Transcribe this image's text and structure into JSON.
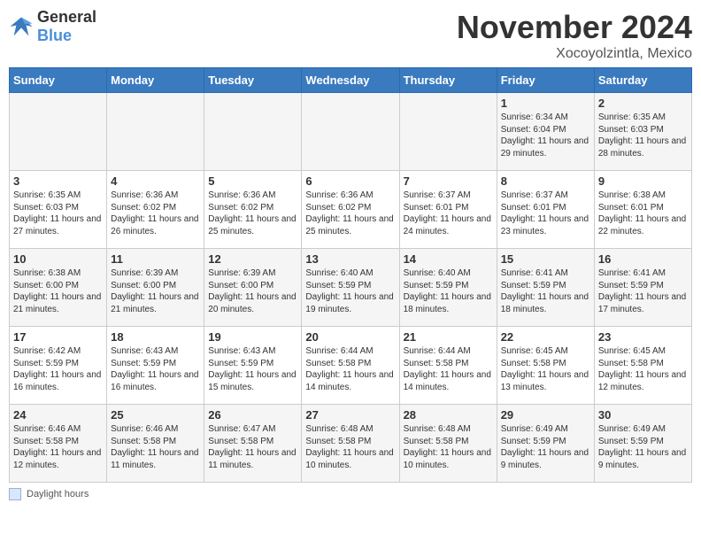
{
  "logo": {
    "general": "General",
    "blue": "Blue"
  },
  "header": {
    "month": "November 2024",
    "location": "Xocoyolzintla, Mexico"
  },
  "days_of_week": [
    "Sunday",
    "Monday",
    "Tuesday",
    "Wednesday",
    "Thursday",
    "Friday",
    "Saturday"
  ],
  "footer": {
    "daylight_label": "Daylight hours"
  },
  "weeks": [
    {
      "days": [
        {
          "num": "",
          "detail": ""
        },
        {
          "num": "",
          "detail": ""
        },
        {
          "num": "",
          "detail": ""
        },
        {
          "num": "",
          "detail": ""
        },
        {
          "num": "",
          "detail": ""
        },
        {
          "num": "1",
          "detail": "Sunrise: 6:34 AM\nSunset: 6:04 PM\nDaylight: 11 hours and 29 minutes."
        },
        {
          "num": "2",
          "detail": "Sunrise: 6:35 AM\nSunset: 6:03 PM\nDaylight: 11 hours and 28 minutes."
        }
      ]
    },
    {
      "days": [
        {
          "num": "3",
          "detail": "Sunrise: 6:35 AM\nSunset: 6:03 PM\nDaylight: 11 hours and 27 minutes."
        },
        {
          "num": "4",
          "detail": "Sunrise: 6:36 AM\nSunset: 6:02 PM\nDaylight: 11 hours and 26 minutes."
        },
        {
          "num": "5",
          "detail": "Sunrise: 6:36 AM\nSunset: 6:02 PM\nDaylight: 11 hours and 25 minutes."
        },
        {
          "num": "6",
          "detail": "Sunrise: 6:36 AM\nSunset: 6:02 PM\nDaylight: 11 hours and 25 minutes."
        },
        {
          "num": "7",
          "detail": "Sunrise: 6:37 AM\nSunset: 6:01 PM\nDaylight: 11 hours and 24 minutes."
        },
        {
          "num": "8",
          "detail": "Sunrise: 6:37 AM\nSunset: 6:01 PM\nDaylight: 11 hours and 23 minutes."
        },
        {
          "num": "9",
          "detail": "Sunrise: 6:38 AM\nSunset: 6:01 PM\nDaylight: 11 hours and 22 minutes."
        }
      ]
    },
    {
      "days": [
        {
          "num": "10",
          "detail": "Sunrise: 6:38 AM\nSunset: 6:00 PM\nDaylight: 11 hours and 21 minutes."
        },
        {
          "num": "11",
          "detail": "Sunrise: 6:39 AM\nSunset: 6:00 PM\nDaylight: 11 hours and 21 minutes."
        },
        {
          "num": "12",
          "detail": "Sunrise: 6:39 AM\nSunset: 6:00 PM\nDaylight: 11 hours and 20 minutes."
        },
        {
          "num": "13",
          "detail": "Sunrise: 6:40 AM\nSunset: 5:59 PM\nDaylight: 11 hours and 19 minutes."
        },
        {
          "num": "14",
          "detail": "Sunrise: 6:40 AM\nSunset: 5:59 PM\nDaylight: 11 hours and 18 minutes."
        },
        {
          "num": "15",
          "detail": "Sunrise: 6:41 AM\nSunset: 5:59 PM\nDaylight: 11 hours and 18 minutes."
        },
        {
          "num": "16",
          "detail": "Sunrise: 6:41 AM\nSunset: 5:59 PM\nDaylight: 11 hours and 17 minutes."
        }
      ]
    },
    {
      "days": [
        {
          "num": "17",
          "detail": "Sunrise: 6:42 AM\nSunset: 5:59 PM\nDaylight: 11 hours and 16 minutes."
        },
        {
          "num": "18",
          "detail": "Sunrise: 6:43 AM\nSunset: 5:59 PM\nDaylight: 11 hours and 16 minutes."
        },
        {
          "num": "19",
          "detail": "Sunrise: 6:43 AM\nSunset: 5:59 PM\nDaylight: 11 hours and 15 minutes."
        },
        {
          "num": "20",
          "detail": "Sunrise: 6:44 AM\nSunset: 5:58 PM\nDaylight: 11 hours and 14 minutes."
        },
        {
          "num": "21",
          "detail": "Sunrise: 6:44 AM\nSunset: 5:58 PM\nDaylight: 11 hours and 14 minutes."
        },
        {
          "num": "22",
          "detail": "Sunrise: 6:45 AM\nSunset: 5:58 PM\nDaylight: 11 hours and 13 minutes."
        },
        {
          "num": "23",
          "detail": "Sunrise: 6:45 AM\nSunset: 5:58 PM\nDaylight: 11 hours and 12 minutes."
        }
      ]
    },
    {
      "days": [
        {
          "num": "24",
          "detail": "Sunrise: 6:46 AM\nSunset: 5:58 PM\nDaylight: 11 hours and 12 minutes."
        },
        {
          "num": "25",
          "detail": "Sunrise: 6:46 AM\nSunset: 5:58 PM\nDaylight: 11 hours and 11 minutes."
        },
        {
          "num": "26",
          "detail": "Sunrise: 6:47 AM\nSunset: 5:58 PM\nDaylight: 11 hours and 11 minutes."
        },
        {
          "num": "27",
          "detail": "Sunrise: 6:48 AM\nSunset: 5:58 PM\nDaylight: 11 hours and 10 minutes."
        },
        {
          "num": "28",
          "detail": "Sunrise: 6:48 AM\nSunset: 5:58 PM\nDaylight: 11 hours and 10 minutes."
        },
        {
          "num": "29",
          "detail": "Sunrise: 6:49 AM\nSunset: 5:59 PM\nDaylight: 11 hours and 9 minutes."
        },
        {
          "num": "30",
          "detail": "Sunrise: 6:49 AM\nSunset: 5:59 PM\nDaylight: 11 hours and 9 minutes."
        }
      ]
    }
  ]
}
